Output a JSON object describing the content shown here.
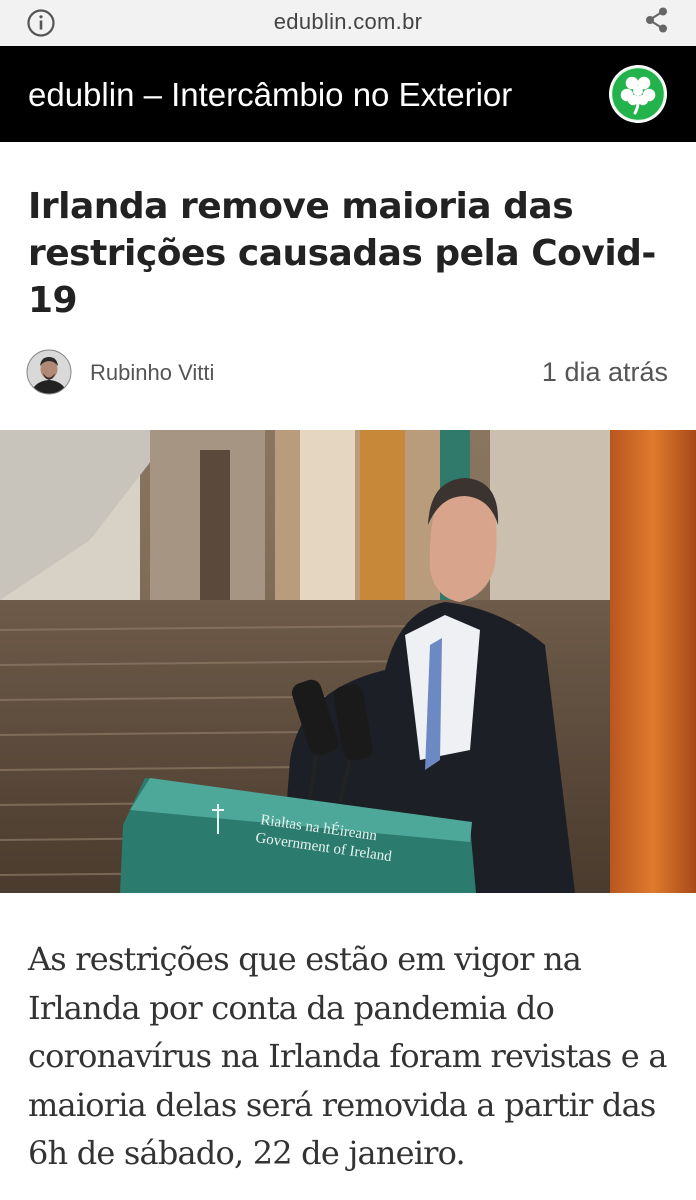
{
  "browser": {
    "url": "edublin.com.br"
  },
  "site": {
    "title": "edublin – Intercâmbio no Exterior"
  },
  "article": {
    "title": "Irlanda remove maioria das restrições causadas pela Covid-19",
    "author": "Rubinho Vitti",
    "date": "1 dia atrás",
    "image": {
      "podium_text_line1": "Rialtas na hÉireann",
      "podium_text_line2": "Government of Ireland"
    },
    "lead": "As restrições que estão em vigor na Irlanda por conta da pandemia do coronavírus na Irlanda foram revistas e a maioria delas será removida a partir das 6h de sábado, 22 de janeiro."
  },
  "colors": {
    "header_bg": "#000000",
    "url_bar_bg": "#f2f2f2",
    "logo_green": "#22b14c"
  }
}
